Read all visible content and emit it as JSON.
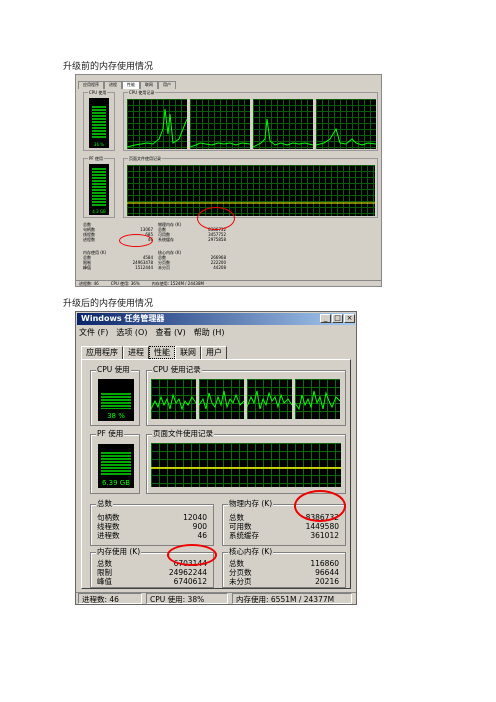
{
  "captions": {
    "before": "升级前的内存使用情况",
    "after": "升级后的内存使用情况"
  },
  "colors": {
    "accent": "#e00000",
    "graph_line": "#00ff00"
  },
  "small": {
    "tabs": [
      "应用程序",
      "进程",
      "性能",
      "联网",
      "用户"
    ],
    "cpu_usage": "CPU 使用",
    "cpu_history": "CPU 使用记录",
    "pf_usage": "PF 使用",
    "pf_history": "页面文件使用记录",
    "cpu_value": "36 %",
    "pf_value": "4.3 GB",
    "totals": {
      "title": "总数",
      "rows": [
        [
          "句柄数",
          "13067"
        ],
        [
          "线程数",
          "685"
        ],
        [
          "进程数",
          "46"
        ]
      ]
    },
    "physical": {
      "title": "物理内存 (K)",
      "rows": [
        [
          "总数",
          "8386732"
        ],
        [
          "可用数",
          "3457752"
        ],
        [
          "系统缓存",
          "2975858"
        ]
      ]
    },
    "commit": {
      "title": "内存使用 (K)",
      "rows": [
        [
          "总数",
          "4584"
        ],
        [
          "限制",
          "24963478"
        ],
        [
          "峰值",
          "1512444"
        ]
      ]
    },
    "kernel": {
      "title": "核心内存 (K)",
      "rows": [
        [
          "总数",
          "266968"
        ],
        [
          "分页数",
          "222200"
        ],
        [
          "未分页",
          "44208"
        ]
      ]
    },
    "status": [
      "进程数: 46",
      "CPU 使用: 36%",
      "内存使用: 1524M / 24438M"
    ]
  },
  "large": {
    "title": "Windows 任务管理器",
    "menu": [
      "文件 (F)",
      "选项 (O)",
      "查看 (V)",
      "帮助 (H)"
    ],
    "tabs": [
      "应用程序",
      "进程",
      "性能",
      "联网",
      "用户"
    ],
    "cpu_usage": "CPU 使用",
    "cpu_history": "CPU 使用记录",
    "pf_usage": "PF 使用",
    "pf_history": "页面文件使用记录",
    "cpu_value": "38 %",
    "pf_value": "6.39 GB",
    "totals": {
      "title": "总数",
      "rows": [
        [
          "句柄数",
          "12040"
        ],
        [
          "线程数",
          "900"
        ],
        [
          "进程数",
          "46"
        ]
      ]
    },
    "physical": {
      "title": "物理内存 (K)",
      "rows": [
        [
          "总数",
          "8386732"
        ],
        [
          "可用数",
          "1449580"
        ],
        [
          "系统缓存",
          "361012"
        ]
      ]
    },
    "commit": {
      "title": "内存使用 (K)",
      "rows": [
        [
          "总数",
          "6703144"
        ],
        [
          "限制",
          "24962244"
        ],
        [
          "峰值",
          "6740612"
        ]
      ]
    },
    "kernel": {
      "title": "核心内存 (K)",
      "rows": [
        [
          "总数",
          "116860"
        ],
        [
          "分页数",
          "96644"
        ],
        [
          "未分页",
          "20216"
        ]
      ]
    },
    "status": [
      "进程数: 46",
      "CPU 使用: 38%",
      "内存使用: 6551M / 24377M"
    ]
  }
}
